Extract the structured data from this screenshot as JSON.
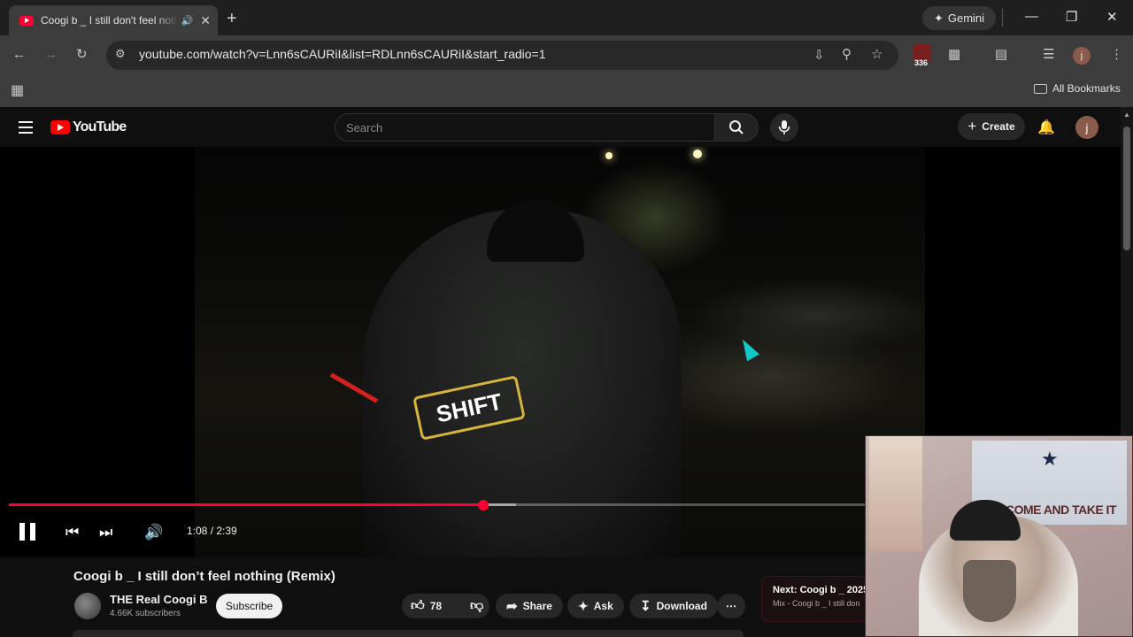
{
  "browser": {
    "tab_title": "Coogi b _ I still don't feel nothing (Remix)",
    "new_tab": "+",
    "gemini_label": "Gemini",
    "url": "youtube.com/watch?v=Lnn6sCAURiI&list=RDLnn6sCAURiI&start_radio=1",
    "extension_badge": "336",
    "profile_initial": "j",
    "all_bookmarks": "All Bookmarks"
  },
  "youtube": {
    "logo_text": "YouTube",
    "search_placeholder": "Search",
    "create_label": "Create",
    "avatar_initial": "j"
  },
  "player": {
    "time_current": "1:08",
    "time_total": "2:39",
    "time_display": "1:08 / 2:39",
    "progress_fraction": 0.43,
    "buffered_fraction": 0.46,
    "shirt_text": "SHIFT"
  },
  "video": {
    "title": "Coogi b _ I still don’t feel nothing (Remix)",
    "channel_name": "THE Real Coogi B",
    "subscribers": "4.66K subscribers",
    "subscribe_label": "Subscribe",
    "likes": "78",
    "share_label": "Share",
    "ask_label": "Ask",
    "download_label": "Download",
    "next_prefix": "Next:",
    "next_title": "Coogi b _ 2025",
    "next_subtitle": "Mix - Coogi b _ I still don"
  },
  "webcam": {
    "flag_text": "COME AND TAKE IT"
  },
  "colors": {
    "accent_red": "#ff0033",
    "background": "#0f0f0f",
    "chrome_toolbar": "#3c3c3c"
  }
}
